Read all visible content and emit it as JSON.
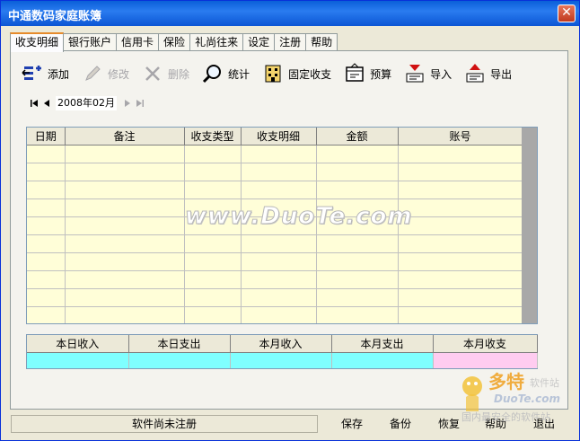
{
  "window": {
    "title": "中通数码家庭账簿",
    "close_label": "✕"
  },
  "tabs": [
    {
      "label": "收支明细",
      "active": true
    },
    {
      "label": "银行账户"
    },
    {
      "label": "信用卡"
    },
    {
      "label": "保险"
    },
    {
      "label": "礼尚往来"
    },
    {
      "label": "设定"
    },
    {
      "label": "注册"
    },
    {
      "label": "帮助"
    }
  ],
  "toolbar": {
    "add": "添加",
    "edit": "修改",
    "delete": "删除",
    "stats": "统计",
    "fixed": "固定收支",
    "budget": "预算",
    "import": "导入",
    "export": "导出"
  },
  "nav": {
    "month": "2008年02月"
  },
  "grid": {
    "columns": [
      "日期",
      "备注",
      "收支类型",
      "收支明细",
      "金额",
      "账号"
    ],
    "rows": []
  },
  "watermark": "www.DuoTe.com",
  "summary": {
    "columns": [
      "本日收入",
      "本日支出",
      "本月收入",
      "本月支出",
      "本月收支"
    ],
    "colors": {
      "normal": "#7fffff",
      "balance": "#ffccf0"
    }
  },
  "status": {
    "text": "软件尚未注册"
  },
  "bottom": {
    "save": "保存",
    "backup": "备份",
    "restore": "恢复",
    "help": "帮助",
    "exit": "退出"
  },
  "logo": {
    "text": "多特",
    "subtext": "软件站",
    "url_text": "DuoTe.com",
    "slogan": "国内最安全的软件站"
  }
}
